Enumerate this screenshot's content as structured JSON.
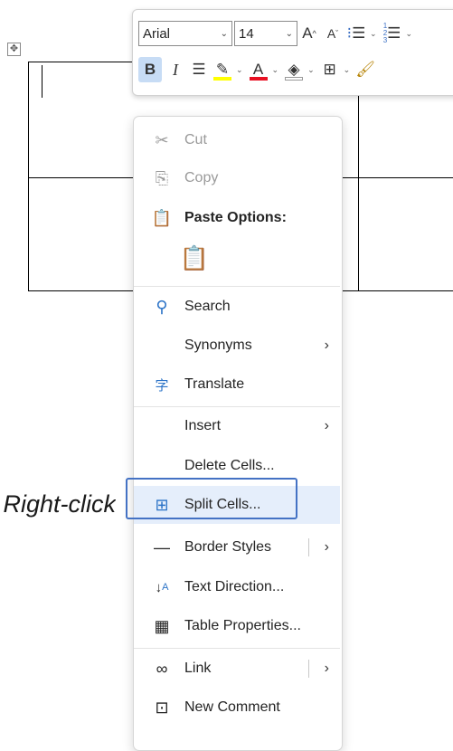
{
  "toolbar": {
    "font_name": "Arial",
    "font_size": "14",
    "grow_font_glyph": "A",
    "shrink_font_glyph": "A",
    "bold_glyph": "B",
    "italic_glyph": "I",
    "font_color_glyph": "A",
    "highlight_color": "#ffff00",
    "font_color": "#e81123"
  },
  "menu": {
    "items": [
      {
        "label": "Cut",
        "icon": "scissors-icon",
        "enabled": false
      },
      {
        "label": "Copy",
        "icon": "copy-icon",
        "enabled": false
      },
      {
        "label": "Paste Options:",
        "icon": "clipboard-icon",
        "enabled": true
      },
      {
        "label": "Search",
        "icon": "search-icon",
        "enabled": true
      },
      {
        "label": "Synonyms",
        "icon": "",
        "enabled": true,
        "submenu": true
      },
      {
        "label": "Translate",
        "icon": "translate-icon",
        "enabled": true
      },
      {
        "label": "Insert",
        "icon": "",
        "enabled": true,
        "submenu": true
      },
      {
        "label": "Delete Cells...",
        "icon": "",
        "enabled": true
      },
      {
        "label": "Split Cells...",
        "icon": "split-cells-icon",
        "enabled": true,
        "highlighted": true
      },
      {
        "label": "Border Styles",
        "icon": "border-icon",
        "enabled": true,
        "submenu": true
      },
      {
        "label": "Text Direction...",
        "icon": "text-direction-icon",
        "enabled": true
      },
      {
        "label": "Table Properties...",
        "icon": "table-properties-icon",
        "enabled": true
      },
      {
        "label": "Link",
        "icon": "link-icon",
        "enabled": true,
        "submenu": true
      },
      {
        "label": "New Comment",
        "icon": "new-comment-icon",
        "enabled": true
      }
    ]
  },
  "annotation": {
    "text": "Right-click"
  },
  "colors": {
    "accent_border": "#4472c4",
    "highlight_bg": "#e5eefb",
    "bold_active_bg": "#c7dcf5"
  }
}
